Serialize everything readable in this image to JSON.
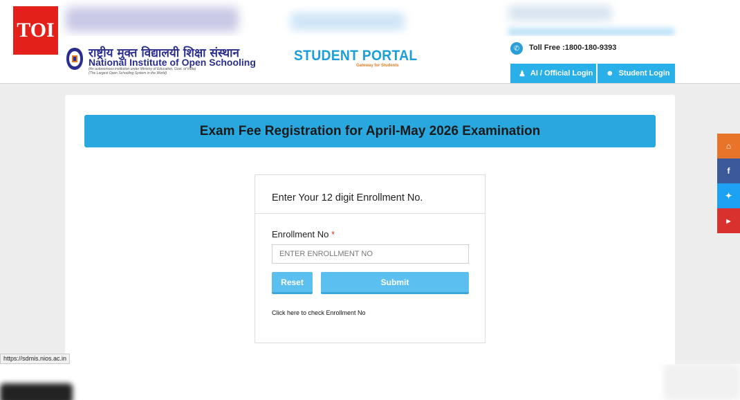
{
  "toi_badge": "TOI",
  "header": {
    "logo_hindi": "राष्ट्रीय मुक्त विद्यालयी शिक्षा संस्थान",
    "logo_english_prefix": "National Institute of ",
    "logo_english_bold": "Open Schooling",
    "logo_sub": "(An autonomous institution under Ministry of Education, Govt. of India)",
    "logo_sub2": "(The Largest Open Schooling System in the World)",
    "portal_title": "STUDENT PORTAL",
    "portal_subtitle": "Gateway for Students",
    "tollfree": "Toll Free :1800-180-9393",
    "ai_login_label": "AI / Official Login",
    "student_login_label": "Student Login"
  },
  "banner": {
    "title": "Exam Fee Registration for April-May 2026 Examination"
  },
  "form": {
    "heading": "Enter Your 12 digit Enrollment No.",
    "field_label": "Enrollment No",
    "required_mark": "*",
    "placeholder": "ENTER ENROLLMENT NO",
    "value": "",
    "reset_label": "Reset",
    "submit_label": "Submit",
    "check_link": "Click here to check Enrollment No"
  },
  "social": {
    "home_icon": "home-icon",
    "facebook_icon": "facebook-icon",
    "twitter_icon": "twitter-icon",
    "youtube_icon": "youtube-icon"
  },
  "status_url": "https://sdmis.nios.ac.in",
  "colors": {
    "accent": "#29a8e0",
    "button": "#5bc0ef",
    "toi_red": "#e4201b"
  }
}
